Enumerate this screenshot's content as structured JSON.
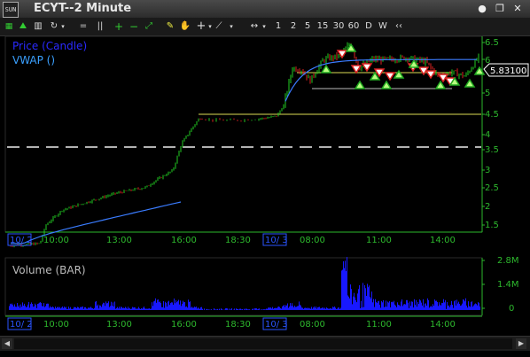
{
  "window": {
    "title": "ECYT--2 Minute",
    "app_icon_text": "SUN"
  },
  "toolbar": {
    "bar_buttons": [
      "1",
      "2",
      "5",
      "15",
      "30",
      "60",
      "D",
      "W"
    ],
    "chevron": "‹‹"
  },
  "price_panel": {
    "legend_price": "Price (Candle)",
    "legend_vwap": "VWAP ()",
    "last_price": "5.83100",
    "y_ticks": [
      "6.5",
      "6",
      "5.5",
      "5",
      "4.5",
      "4",
      "3.5",
      "3",
      "2.5",
      "2",
      "1.5"
    ]
  },
  "volume_panel": {
    "legend": "Volume (BAR)",
    "y_ticks": [
      "2.8M",
      "1.4M",
      "0"
    ]
  },
  "x_axis": {
    "labels": [
      "10/ 2",
      "10:00",
      "13:00",
      "16:00",
      "18:30",
      "10/ 3",
      "08:00",
      "11:00",
      "14:00"
    ]
  },
  "colors": {
    "bull": "#22cc22",
    "bear": "#dd2222",
    "vwap": "#3a7cff",
    "volume": "#1818ff",
    "axis": "#2db82d",
    "level": "#dddd55"
  }
}
